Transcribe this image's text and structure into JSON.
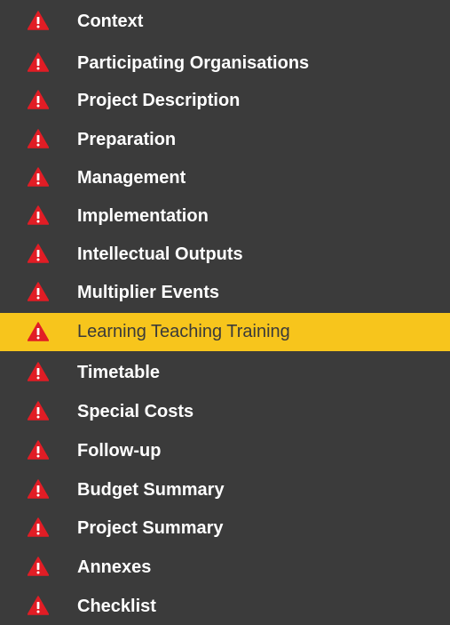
{
  "navigation": {
    "items": [
      {
        "label": "Context",
        "icon": "warning-icon",
        "status": "warning"
      },
      {
        "label": "Participating Organisations",
        "icon": "warning-icon",
        "status": "warning"
      },
      {
        "label": "Project Description",
        "icon": "warning-icon",
        "status": "warning"
      },
      {
        "label": "Preparation",
        "icon": "warning-icon",
        "status": "warning"
      },
      {
        "label": "Management",
        "icon": "warning-icon",
        "status": "warning"
      },
      {
        "label": "Implementation",
        "icon": "warning-icon",
        "status": "warning"
      },
      {
        "label": "Intellectual Outputs",
        "icon": "warning-icon",
        "status": "warning"
      },
      {
        "label": "Multiplier Events",
        "icon": "warning-icon",
        "status": "warning"
      },
      {
        "label": "Learning Teaching Training",
        "icon": "warning-icon",
        "status": "warning",
        "active": true
      },
      {
        "label": "Timetable",
        "icon": "warning-icon",
        "status": "warning"
      },
      {
        "label": "Special Costs",
        "icon": "warning-icon",
        "status": "warning"
      },
      {
        "label": "Follow-up",
        "icon": "warning-icon",
        "status": "warning"
      },
      {
        "label": "Budget Summary",
        "icon": "warning-icon",
        "status": "warning"
      },
      {
        "label": "Project Summary",
        "icon": "warning-icon",
        "status": "warning"
      },
      {
        "label": "Annexes",
        "icon": "warning-icon",
        "status": "warning"
      },
      {
        "label": "Checklist",
        "icon": "warning-icon",
        "status": "warning"
      }
    ]
  },
  "colors": {
    "background": "#3b3b3b",
    "active_background": "#f7c51c",
    "warning_icon": "#e11d25",
    "text": "#ffffff",
    "active_text": "#3a3a3a"
  }
}
